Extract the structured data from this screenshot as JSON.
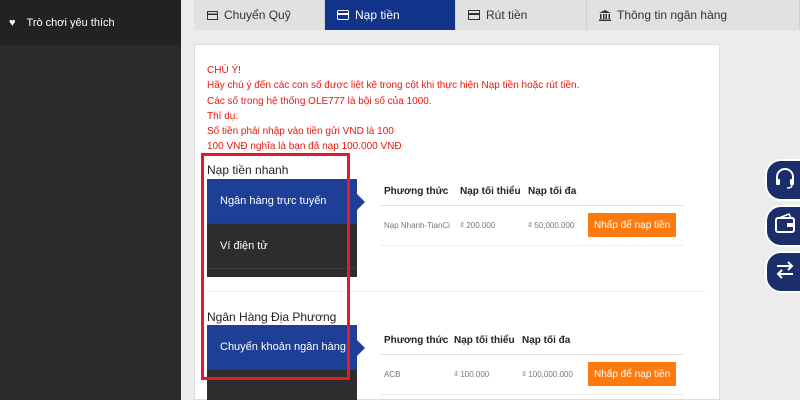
{
  "sidebar": {
    "favorite_label": "Trò chơi yêu thích"
  },
  "tabs": [
    {
      "label": "Chuyển Quỹ",
      "icon": "wallet-icon"
    },
    {
      "label": "Nạp tiền",
      "icon": "card-icon"
    },
    {
      "label": "Rút tiền",
      "icon": "withdraw-icon"
    },
    {
      "label": "Thông tin ngân hàng",
      "icon": "bank-icon"
    }
  ],
  "notice": {
    "lines": [
      "CHÚ Ý!",
      "Hãy chú ý đến các con số được liệt kê trong cột khi thực hiện Nạp tiền hoặc rút tiền.",
      "Các số trong hệ thống OLE777 là bội số của 1000.",
      "Thí dụ:",
      "Số tiền phải nhập vào tiền gửi VND là 100",
      "100 VNĐ nghĩa là bạn đã nạp 100.000 VNĐ"
    ]
  },
  "quick": {
    "title": "Nạp tiền nhanh",
    "menu": [
      "Ngân hàng trực tuyến",
      "Ví điện tử"
    ],
    "headers": [
      "Phương thức",
      "Nạp tối thiểu",
      "Nạp tối đa"
    ],
    "row": {
      "method": "Nạp Nhanh-TianCi",
      "min": "₫ 200.000",
      "max": "₫ 50,000.000",
      "button": "Nhấp để nạp tiền"
    }
  },
  "local": {
    "title": "Ngân Hàng Địa Phương",
    "menu": [
      "Chuyển khoản ngân hàng"
    ],
    "headers": [
      "Phương thức",
      "Nạp tối thiểu",
      "Nạp tối đa"
    ],
    "row": {
      "method": "ACB",
      "min": "₫ 100.000",
      "max": "₫ 100,000.000",
      "button": "Nhấp để nạp tiền"
    }
  },
  "colors": {
    "primary": "#12338a",
    "accent": "#ff7a0e",
    "notice": "#e8180c",
    "highlight": "#e7192b"
  }
}
